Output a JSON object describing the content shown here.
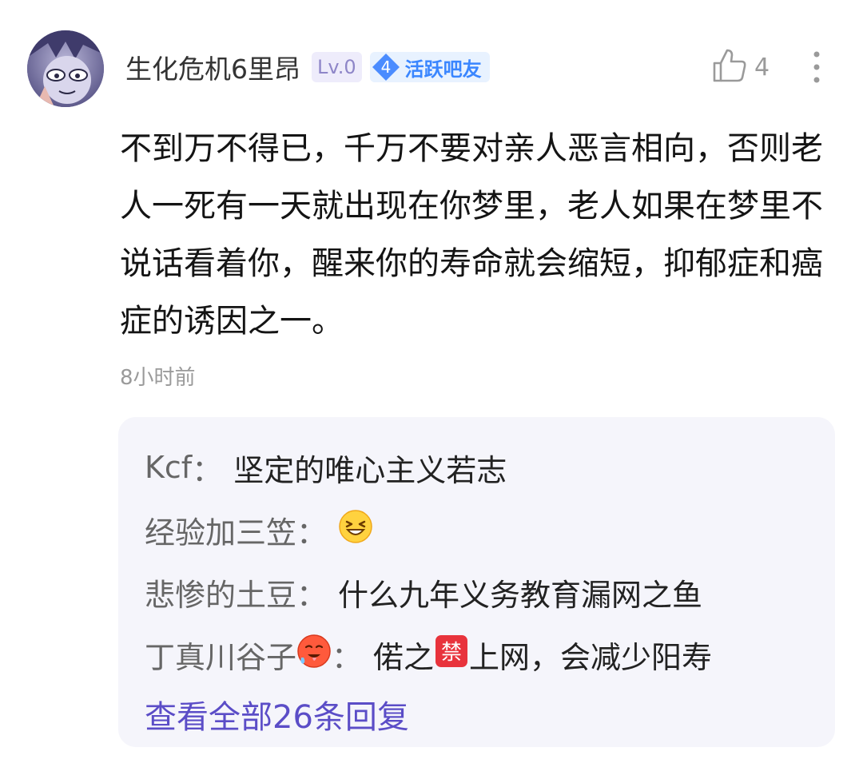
{
  "author": {
    "name": "生化危机6里昂",
    "level": "Lv.0",
    "active_badge_number": "4",
    "active_badge_label": "活跃吧友"
  },
  "likes": {
    "count": "4"
  },
  "comment": {
    "text": "不到万不得已，千万不要对亲人恶言相向，否则老人一死有一天就出现在你梦里，老人如果在梦里不说话看着你，醒来你的寿命就会缩短，抑郁症和癌症的诱因之一。",
    "time": "8小时前"
  },
  "replies": [
    {
      "author": "Kcf",
      "text": "坚定的唯心主义若志"
    },
    {
      "author": "经验加三笠",
      "text": "",
      "emoji": "laughing-face-icon"
    },
    {
      "author": "悲惨的土豆",
      "text": "什么九年义务教育漏网之鱼"
    },
    {
      "author": "丁真川谷子",
      "author_emoji": "hot-face-icon",
      "text_before": "偌之",
      "text_emoji": "prohibited-sign-icon",
      "text_after": "上网，会减少阳寿"
    }
  ],
  "view_all_replies": "查看全部26条回复",
  "colors": {
    "accent_link": "#5b4dc7",
    "badge_blue": "#3a86ff",
    "level_badge": "#8e86c8",
    "reply_background": "#f5f5fb"
  }
}
